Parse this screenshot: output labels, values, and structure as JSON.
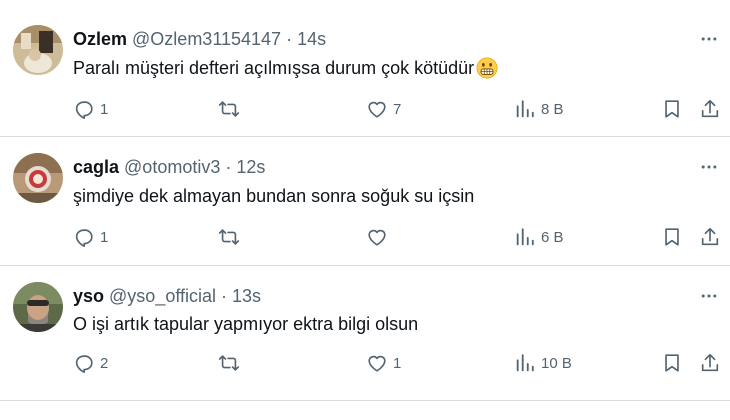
{
  "tweets": [
    {
      "name": "Ozlem",
      "handle": "@Ozlem31154147",
      "separator": "·",
      "time": "14s",
      "text": "Paralı müşteri defteri açılmışsa durum çok kötüdür",
      "emoji": "grimacing-face",
      "replies": "1",
      "retweets": "",
      "likes": "7",
      "views": "8 B"
    },
    {
      "name": "cagla",
      "handle": "@otomotiv3",
      "separator": "·",
      "time": "12s",
      "text": "şimdiye dek almayan bundan sonra soğuk su içsin",
      "replies": "1",
      "retweets": "",
      "likes": "",
      "views": "6 B"
    },
    {
      "name": "yso",
      "handle": "@yso_official",
      "separator": "·",
      "time": "13s",
      "text": "O işi artık tapular yapmıyor ektra bilgi olsun",
      "replies": "2",
      "retweets": "",
      "likes": "1",
      "views": "10 B"
    }
  ],
  "icons": {
    "more": "more-horizontal-icon",
    "reply": "reply-icon",
    "retweet": "retweet-icon",
    "like": "heart-icon",
    "views": "views-chart-icon",
    "bookmark": "bookmark-icon",
    "share": "share-icon"
  },
  "colors": {
    "text": "#0f1419",
    "secondary": "#536471",
    "divider": "#d8dde2"
  }
}
